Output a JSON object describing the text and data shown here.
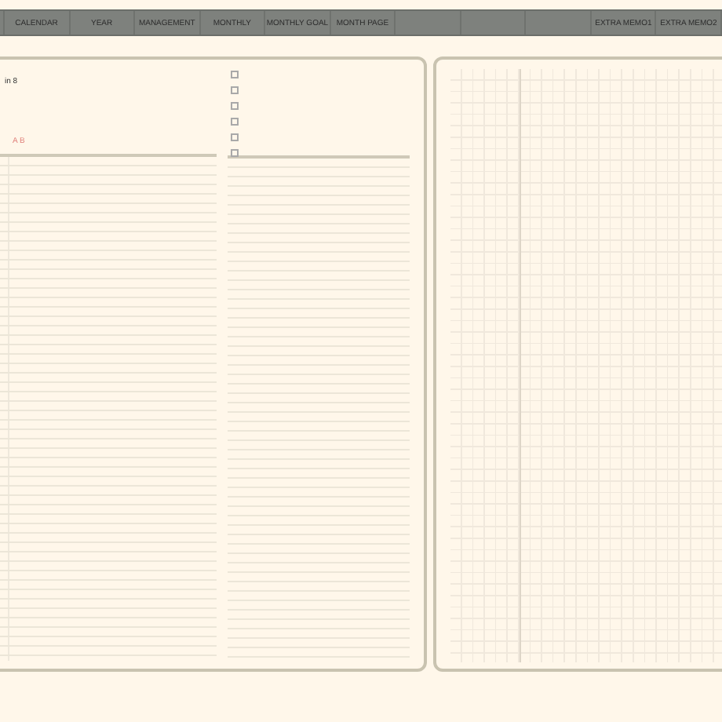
{
  "tabs": [
    {
      "selected": false
    },
    {
      "label": "CALENDAR",
      "selected": false
    },
    {
      "label": "YEAR",
      "selected": false
    },
    {
      "label": "MANAGEMENT",
      "selected": false
    },
    {
      "label": "MONTHLY",
      "selected": false
    },
    {
      "label": "MONTHLY GOAL",
      "selected": false
    },
    {
      "label": "MONTH PAGE",
      "selected": false
    },
    {
      "selected": false
    },
    {
      "selected": false
    },
    {
      "selected": false
    },
    {
      "label": "EXTRA MEMO1",
      "selected": false
    },
    {
      "label": "EXTRA MEMO2",
      "selected": false
    }
  ],
  "left_page": {
    "note": "in 8",
    "accent_text": "A B",
    "checklist": [
      {
        "checked": false
      },
      {
        "checked": false
      },
      {
        "checked": false
      },
      {
        "checked": false
      },
      {
        "checked": false
      },
      {
        "checked": false
      }
    ]
  }
}
